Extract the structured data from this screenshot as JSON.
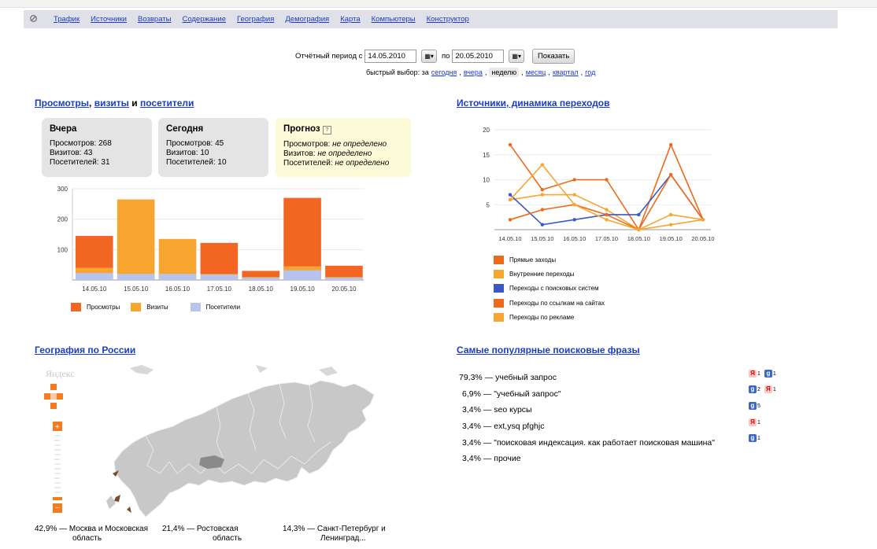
{
  "nav": {
    "home_icon": "home-icon",
    "items": [
      "Трафик",
      "Источники",
      "Возвраты",
      "Содержание",
      "География",
      "Демография",
      "Карта",
      "Компьютеры",
      "Конструктор"
    ]
  },
  "period": {
    "label": "Отчётный период с",
    "from": "14.05.2010",
    "to_label": "по",
    "to": "20.05.2010",
    "calendar_icon": "calendar-icon",
    "show_button": "Показать"
  },
  "quick": {
    "label": "быстрый выбор: за",
    "options": [
      "сегодня",
      "вчера",
      "неделю",
      "месяц",
      "квартал",
      "год"
    ],
    "selected": "неделю"
  },
  "views_section": {
    "title_link1": "Просмотры",
    "sep1": ",",
    "title_link2": "визиты",
    "sep2": "и",
    "title_link3": "посетители"
  },
  "cards": {
    "yesterday": {
      "title": "Вчера",
      "views": "Просмотров: 268",
      "visits": "Визитов: 43",
      "visitors": "Посетителей: 31"
    },
    "today": {
      "title": "Сегодня",
      "views": "Просмотров: 45",
      "visits": "Визитов: 10",
      "visitors": "Посетителей: 10"
    },
    "forecast": {
      "title": "Прогноз",
      "views_label": "Просмотров:",
      "visits_label": "Визитов:",
      "visitors_label": "Посетителей:",
      "value": "не определено"
    }
  },
  "sources_section": {
    "title": "Источники, динамика переходов"
  },
  "geo_section": {
    "title": "География по России",
    "map_logo": "Яндекс"
  },
  "phrases_section": {
    "title": "Самые популярные поисковые фразы"
  },
  "chart_data": [
    {
      "type": "bar",
      "categories": [
        "14.05.10",
        "15.05.10",
        "16.05.10",
        "17.05.10",
        "18.05.10",
        "19.05.10",
        "20.05.10"
      ],
      "series": [
        {
          "name": "Просмотры",
          "color": "#f26522",
          "values": [
            145,
            0,
            0,
            122,
            30,
            270,
            47
          ]
        },
        {
          "name": "Визиты",
          "color": "#f7a531",
          "values": [
            40,
            265,
            135,
            20,
            10,
            45,
            10
          ]
        },
        {
          "name": "Посетители",
          "color": "#b6c4ee",
          "values": [
            23,
            20,
            20,
            18,
            8,
            32,
            8
          ]
        }
      ],
      "yticks": [
        100,
        200,
        300
      ],
      "ylim": [
        0,
        300
      ]
    },
    {
      "type": "line",
      "categories": [
        "14.05.10",
        "15.05.10",
        "16.05.10",
        "17.05.10",
        "18.05.10",
        "19.05.10",
        "20.05.10"
      ],
      "yticks": [
        5,
        10,
        15,
        20
      ],
      "ylim": [
        0,
        20
      ],
      "series": [
        {
          "name": "Прямые заходы",
          "color": "#ee6a1a",
          "values": [
            17,
            8,
            10,
            10,
            0,
            17,
            2
          ]
        },
        {
          "name": "Внутренние переходы",
          "color": "#f7a531",
          "values": [
            6,
            7,
            7,
            4,
            0,
            3,
            2
          ]
        },
        {
          "name": "Переходы с поисковых систем",
          "color": "#3a57c9",
          "values": [
            7,
            1,
            2,
            3,
            3,
            11,
            2
          ]
        },
        {
          "name": "Переходы по ссылкам на сайтах",
          "color": "#ee6a1a",
          "values": [
            2,
            4,
            5,
            3,
            0,
            11,
            2
          ]
        },
        {
          "name": "Переходы по рекламе",
          "color": "#f7a531",
          "values": [
            6,
            13,
            5,
            2,
            0,
            1,
            2
          ]
        }
      ]
    }
  ],
  "phrases": [
    {
      "pct": "79,3% — учебный запрос",
      "engines": [
        {
          "e": "yandex",
          "n": "1"
        },
        {
          "e": "google",
          "n": "1"
        }
      ]
    },
    {
      "pct": "6,9% — \"учебный запрос\"",
      "engines": [
        {
          "e": "google",
          "n": "2"
        },
        {
          "e": "yandex",
          "n": "1"
        }
      ]
    },
    {
      "pct": "3,4% — seo курсы",
      "engines": [
        {
          "e": "google",
          "n": "5"
        }
      ]
    },
    {
      "pct": "3,4% — ext,ysq pfghjc",
      "engines": [
        {
          "e": "yandex",
          "n": "1"
        }
      ]
    },
    {
      "pct": "3,4% — \"поисковая индексация. как работает поисковая машина\"",
      "engines": [
        {
          "e": "google",
          "n": "1"
        }
      ]
    },
    {
      "pct": "3,4% — прочие",
      "engines": []
    }
  ],
  "geo_regions": [
    {
      "pct": "42,9% —",
      "name1": "Москва и Московская",
      "name2": "область"
    },
    {
      "pct": "21,4% —",
      "name1": "Ростовская",
      "name2": "область"
    },
    {
      "pct": "14,3% —",
      "name1": "Санкт-Петербург и",
      "name2": "Ленинград..."
    }
  ],
  "icons": {
    "forecast_help": "help-icon",
    "yandex": "yandex-icon",
    "google": "google-icon"
  }
}
